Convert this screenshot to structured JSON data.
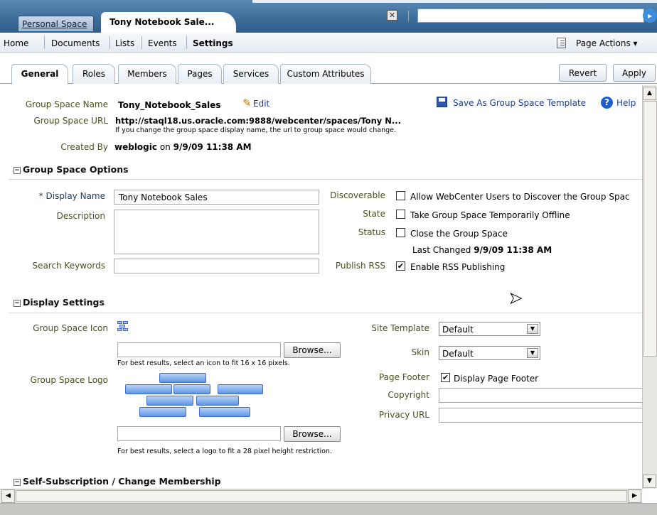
{
  "top": {
    "personal_tab": "Personal Space",
    "active_tab": "Tony Notebook Sale...",
    "close_icon": "close-icon",
    "go_icon": "go-icon",
    "search_value": ""
  },
  "nav": {
    "items": [
      "Home",
      "Documents",
      "Lists",
      "Events",
      "Settings"
    ],
    "page_actions": "Page Actions"
  },
  "tabs": {
    "items": [
      "General",
      "Roles",
      "Members",
      "Pages",
      "Services",
      "Custom Attributes"
    ],
    "active": "General",
    "revert": "Revert",
    "apply": "Apply"
  },
  "info": {
    "name_label": "Group Space Name",
    "name_value": "Tony_Notebook_Sales",
    "edit_link": "Edit",
    "url_label": "Group Space URL",
    "url_value": "http://staql18.us.oracle.com:9888/webcenter/spaces/Tony N...",
    "url_note": "If you change the group space display name, the url to group space would change.",
    "created_label": "Created By",
    "created_user": "weblogic",
    "created_on": "on",
    "created_date": "9/9/09 11:38 AM",
    "save_template": "Save As Group Space Template",
    "help": "Help"
  },
  "options": {
    "title": "Group Space Options",
    "display_name_label": "Display Name",
    "display_name_value": "Tony Notebook Sales",
    "description_label": "Description",
    "description_value": "",
    "keywords_label": "Search Keywords",
    "keywords_value": "",
    "discoverable_label": "Discoverable",
    "discoverable_text": "Allow WebCenter Users to Discover the Group Spac",
    "discoverable_checked": false,
    "state_label": "State",
    "state_text": "Take Group Space Temporarily Offline",
    "state_checked": false,
    "status_label": "Status",
    "status_text": "Close the Group Space",
    "status_checked": false,
    "last_changed_label": "Last Changed",
    "last_changed_value": "9/9/09 11:38 AM",
    "rss_label": "Publish RSS",
    "rss_text": "Enable RSS Publishing",
    "rss_checked": true
  },
  "display": {
    "title": "Display Settings",
    "icon_label": "Group Space Icon",
    "browse_label": "Browse...",
    "icon_note": "For best results, select an icon to fit 16 x 16 pixels.",
    "logo_label": "Group Space Logo",
    "logo_note": "For best results, select a logo to fit a 28 pixel height restriction.",
    "site_template_label": "Site Template",
    "site_template_value": "Default",
    "skin_label": "Skin",
    "skin_value": "Default",
    "footer_label": "Page Footer",
    "footer_text": "Display Page Footer",
    "footer_checked": true,
    "copyright_label": "Copyright",
    "copyright_value": "",
    "privacy_label": "Privacy URL",
    "privacy_value": ""
  },
  "subscription": {
    "title": "Self-Subscription / Change Membership"
  },
  "colors": {
    "header_blue": "#3b6b99",
    "label_olive": "#4c4f1f",
    "link_blue": "#1c3d8f"
  }
}
